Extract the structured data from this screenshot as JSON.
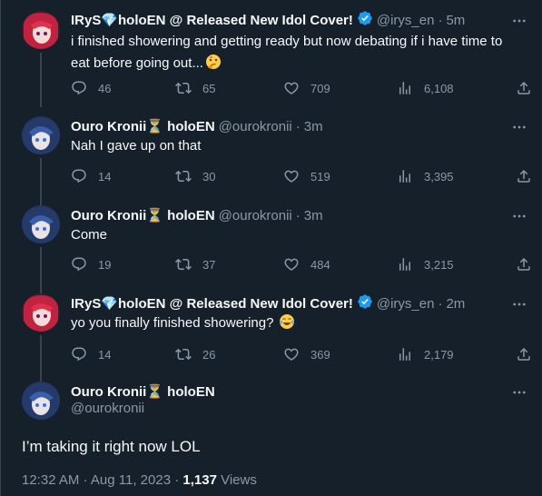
{
  "tweets": [
    {
      "name": "IRyS💎holoEN @ Released New Idol Cover!",
      "handle": "@irys_en",
      "dot": "·",
      "time": "5m",
      "text_line1": "i finished showering and getting ready but now debating if i have time to",
      "text_line2": "eat before going out...",
      "emoji": "thinking-face",
      "replies": "46",
      "retweets": "65",
      "likes": "709",
      "views": "6,108"
    },
    {
      "name": "Ouro Kronii⏳ holoEN",
      "handle": "@ourokronii",
      "dot": "·",
      "time": "3m",
      "text": "Nah I gave up on that",
      "replies": "14",
      "retweets": "30",
      "likes": "519",
      "views": "3,395"
    },
    {
      "name": "Ouro Kronii⏳ holoEN",
      "handle": "@ourokronii",
      "dot": "·",
      "time": "3m",
      "text": "Come",
      "replies": "19",
      "retweets": "37",
      "likes": "484",
      "views": "3,215"
    },
    {
      "name": "IRyS💎holoEN @ Released New Idol Cover!",
      "handle": "@irys_en",
      "dot": "·",
      "time": "2m",
      "text": "yo you finally finished showering?",
      "emoji": "face-with-tears-of-joy",
      "replies": "14",
      "retweets": "26",
      "likes": "369",
      "views": "2,179"
    }
  ],
  "main_tweet": {
    "name": "Ouro Kronii⏳ holoEN",
    "handle": "@ourokronii",
    "text": "I’m taking it right now LOL",
    "time": "12:32 AM",
    "dot1": "·",
    "date": "Aug 11, 2023",
    "dot2": "·",
    "views_count": "1,137",
    "views_label": "Views"
  },
  "colors": {
    "background": "#15202b",
    "text": "#f7f9f9",
    "muted": "#8b98a5",
    "verified": "#1d9bf0",
    "thread_line": "#38444d"
  }
}
